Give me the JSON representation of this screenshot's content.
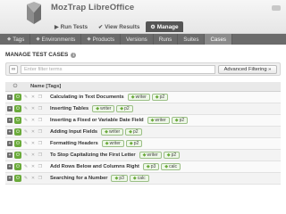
{
  "app": {
    "title": "MozTrap LibreOffice"
  },
  "main_nav": [
    {
      "label": "Run Tests",
      "icon": "play-icon"
    },
    {
      "label": "View Results",
      "icon": "check-icon"
    },
    {
      "label": "Manage",
      "icon": "gear-icon"
    }
  ],
  "sub_nav": [
    {
      "label": "Tags"
    },
    {
      "label": "Environments"
    },
    {
      "label": "Products"
    },
    {
      "label": "Versions"
    },
    {
      "label": "Runs"
    },
    {
      "label": "Suites"
    },
    {
      "label": "Cases"
    }
  ],
  "section": {
    "title": "MANAGE TEST CASES"
  },
  "filter": {
    "placeholder": "Enter filter terms",
    "advanced_label": "Advanced Filtering »"
  },
  "table": {
    "name_header": "Name [Tags]",
    "rows": [
      {
        "name": "Calculating in Text Documents",
        "tags": [
          "writer",
          "p2"
        ]
      },
      {
        "name": "Inserting Tables",
        "tags": [
          "writer",
          "p2"
        ]
      },
      {
        "name": "Inserting a Fixed or Variable Date Field",
        "tags": [
          "writer",
          "p2"
        ]
      },
      {
        "name": "Adding Input Fields",
        "tags": [
          "writer",
          "p2"
        ]
      },
      {
        "name": "Formatting Headers",
        "tags": [
          "writer",
          "p2"
        ]
      },
      {
        "name": "To Stop Capitalizing the First Letter",
        "tags": [
          "writer",
          "p2"
        ]
      },
      {
        "name": "Add Rows Below and Columns Right",
        "tags": [
          "p3",
          "calc"
        ]
      },
      {
        "name": "Searching for a Number",
        "tags": [
          "p3",
          "calc"
        ]
      }
    ]
  }
}
